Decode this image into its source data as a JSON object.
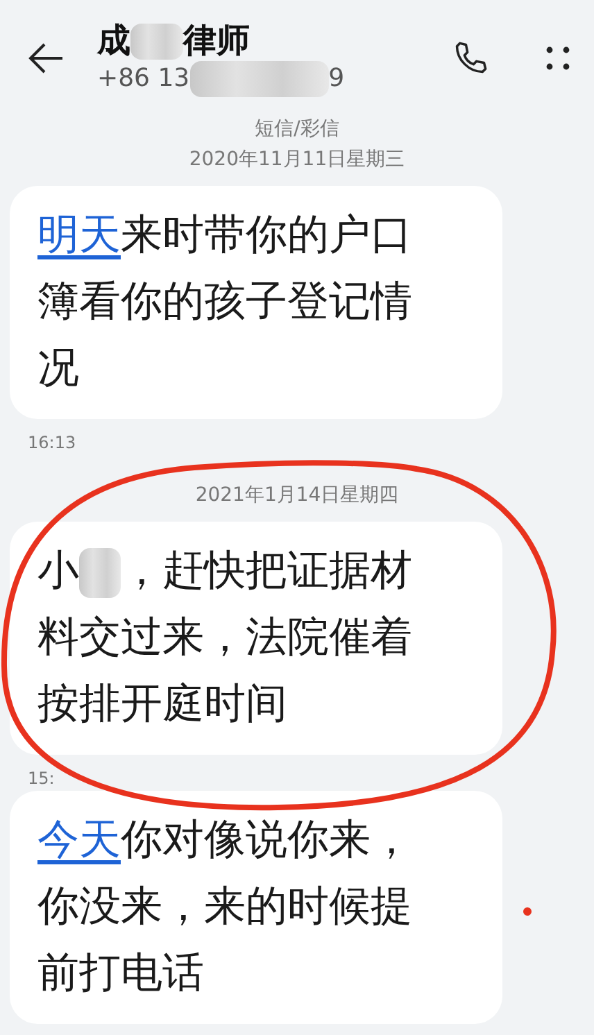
{
  "header": {
    "name_parts": [
      {
        "kind": "text",
        "text": "成"
      },
      {
        "kind": "blur"
      },
      {
        "kind": "text",
        "text": "律师"
      }
    ],
    "number_parts": [
      {
        "kind": "text",
        "text": "+86 13"
      },
      {
        "kind": "blur"
      },
      {
        "kind": "text",
        "text": "9"
      }
    ]
  },
  "conversation": [
    {
      "kind": "separator",
      "lines": [
        "短信/彩信",
        "2020年11月11日星期三"
      ]
    },
    {
      "kind": "message",
      "parts": [
        {
          "kind": "link",
          "text": "明天"
        },
        {
          "kind": "text",
          "text": "来时带你的户口簿看你的孩子登记情况"
        }
      ],
      "time": "16:13"
    },
    {
      "kind": "separator",
      "lines": [
        "2021年1月14日星期四"
      ]
    },
    {
      "kind": "message",
      "parts": [
        {
          "kind": "text",
          "text": "小"
        },
        {
          "kind": "blur"
        },
        {
          "kind": "text",
          "text": "，赶快把证据材料交过来，法院催着按排开庭时间"
        }
      ],
      "time": "15:"
    },
    {
      "kind": "message",
      "parts": [
        {
          "kind": "link",
          "text": "今天"
        },
        {
          "kind": "text",
          "text": "你对像说你来，你没来，来的时候提前打电话"
        }
      ]
    }
  ]
}
